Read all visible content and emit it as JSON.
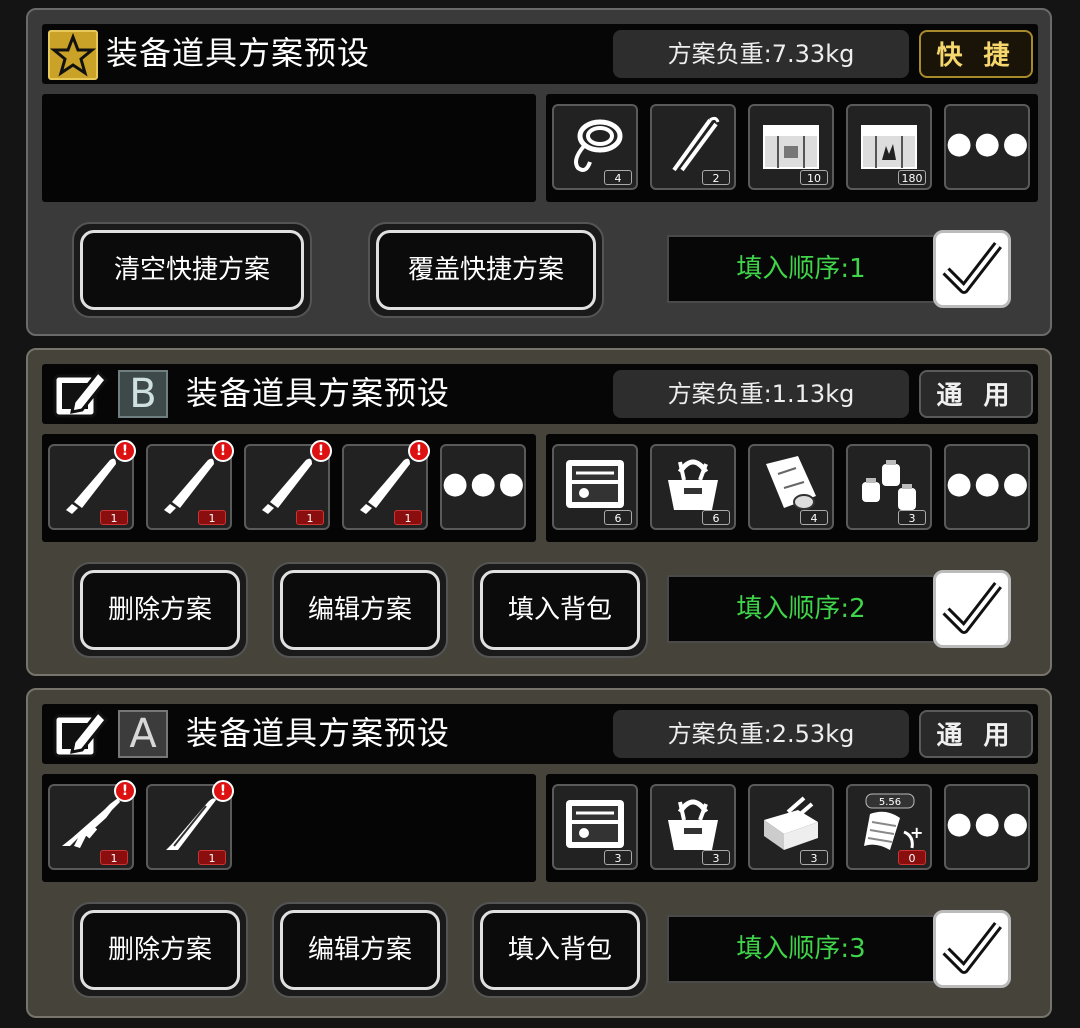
{
  "quick_panel": {
    "title": "装备道具方案预设",
    "weight": "方案负重:7.33kg",
    "mode": "快 捷",
    "items": [
      {
        "icon": "rope-icon",
        "count": "4"
      },
      {
        "icon": "lockpick-icon",
        "count": "2"
      },
      {
        "icon": "ammo-crate-icon",
        "count": "10"
      },
      {
        "icon": "explosive-crate-icon",
        "count": "180"
      }
    ],
    "more": "●●●",
    "buttons": [
      "清空快捷方案",
      "覆盖快捷方案"
    ],
    "order": "填入顺序:1"
  },
  "preset_b": {
    "letter": "B",
    "title": "装备道具方案预设",
    "weight": "方案负重:1.13kg",
    "mode": "通 用",
    "weapons": [
      {
        "icon": "machete-icon",
        "count": "1"
      },
      {
        "icon": "machete-icon",
        "count": "1"
      },
      {
        "icon": "machete-icon",
        "count": "1"
      },
      {
        "icon": "machete-icon",
        "count": "1"
      }
    ],
    "items": [
      {
        "icon": "toolbox-icon",
        "count": "6"
      },
      {
        "icon": "tool-bag-icon",
        "count": "6"
      },
      {
        "icon": "bandage-roll-icon",
        "count": "4"
      },
      {
        "icon": "grenade-icon",
        "count": "3"
      }
    ],
    "more": "●●●",
    "buttons": [
      "删除方案",
      "编辑方案",
      "填入背包"
    ],
    "order": "填入顺序:2"
  },
  "preset_a": {
    "letter": "A",
    "title": "装备道具方案预设",
    "weight": "方案负重:2.53kg",
    "mode": "通 用",
    "weapons": [
      {
        "icon": "rifle-icon",
        "count": "1"
      },
      {
        "icon": "scalpel-icon",
        "count": "1"
      }
    ],
    "items": [
      {
        "icon": "toolbox-icon",
        "count": "3"
      },
      {
        "icon": "tool-bag-icon",
        "count": "3"
      },
      {
        "icon": "repair-kit-icon",
        "count": "3"
      },
      {
        "icon": "magazine-icon",
        "count": "0",
        "caliber": "5.56"
      }
    ],
    "more": "●●●",
    "buttons": [
      "删除方案",
      "编辑方案",
      "填入背包"
    ],
    "order": "填入顺序:3"
  }
}
